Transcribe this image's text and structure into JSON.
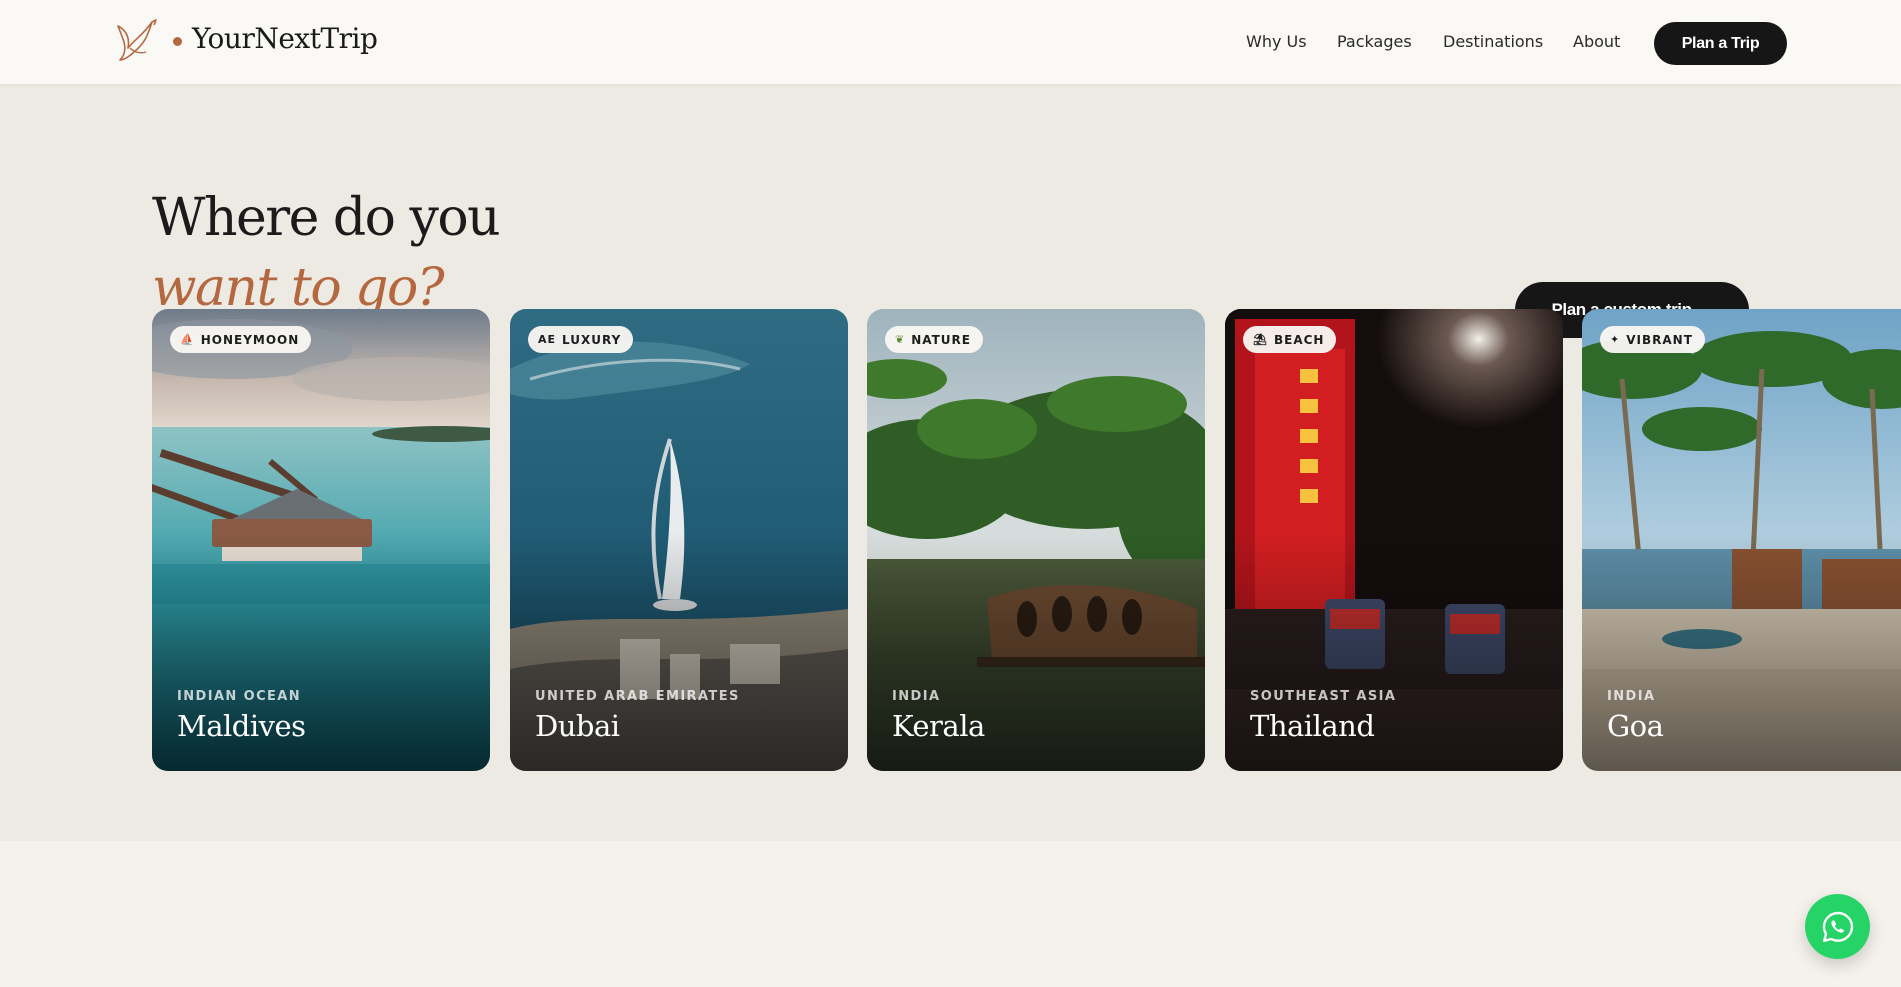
{
  "brand": {
    "name": "YourNextTrip",
    "accent_color": "#b5673f"
  },
  "nav": {
    "items": [
      {
        "label": "Why Us"
      },
      {
        "label": "Packages"
      },
      {
        "label": "Destinations"
      },
      {
        "label": "About"
      }
    ],
    "cta_label": "Plan a Trip"
  },
  "hero": {
    "heading_line1": "Where do you",
    "heading_line2": "want to go?",
    "cta_label": "Plan a custom trip →"
  },
  "destinations": [
    {
      "tag": "HONEYMOON",
      "tag_icon": "couple-icon",
      "region": "INDIAN OCEAN",
      "name": "Maldives"
    },
    {
      "tag": "LUXURY",
      "tag_icon": "uae-flag-icon",
      "region": "UNITED ARAB EMIRATES",
      "name": "Dubai"
    },
    {
      "tag": "NATURE",
      "tag_icon": "leaf-icon",
      "region": "INDIA",
      "name": "Kerala"
    },
    {
      "tag": "BEACH",
      "tag_icon": "beach-icon",
      "region": "SOUTHEAST ASIA",
      "name": "Thailand"
    },
    {
      "tag": "VIBRANT",
      "tag_icon": "festival-icon",
      "region": "INDIA",
      "name": "Goa"
    }
  ],
  "whatsapp": {
    "icon": "whatsapp-icon",
    "color": "#25d366"
  }
}
